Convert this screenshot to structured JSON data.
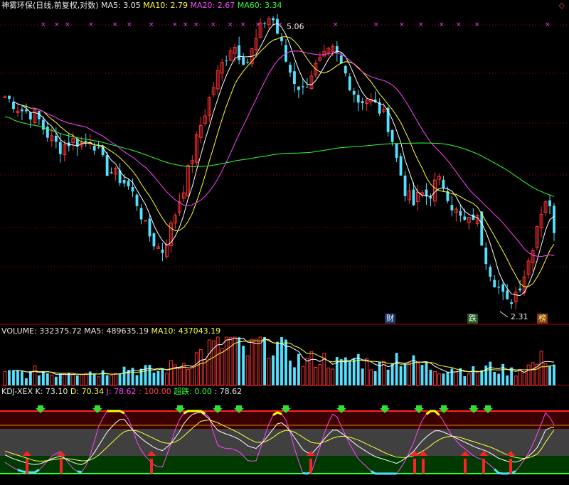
{
  "price_header": {
    "title": "神雾环保(日线,前复权,对数)",
    "ma5": "MA5: 3.05",
    "ma10": "MA10: 2.79",
    "ma20": "MA20: 2.67",
    "ma60": "MA60: 3.34"
  },
  "volume_header": {
    "volume": "VOLUME: 332375.72",
    "ma5": "MA5: 489635.19",
    "ma10": "MA10: 437043.19"
  },
  "kdj_header": {
    "name": "KDJ-XEX",
    "k": "K: 73.10",
    "d": "D: 70.34",
    "j": "J: 78.62",
    "line100": ": 100.00",
    "chaodie": "超跌: 0.00",
    "extra": ": 78.62"
  },
  "annotations": {
    "high_label": "5.06",
    "low_label": "2.31",
    "tag_cai": "财",
    "tag_die": "跌",
    "tag_bang": "榜"
  },
  "colors": {
    "up": "#ff3333",
    "down": "#55e0ff",
    "ma5": "#ffffff",
    "ma10": "#ffff33",
    "ma20": "#ff44ff",
    "ma60": "#33ff33",
    "grid": "#aa0000"
  },
  "chart_data": {
    "type": "candlestick",
    "title": "神雾环保(日线,前复权,对数)",
    "high": 5.06,
    "low": 2.31,
    "last_values": {
      "ma5": 3.05,
      "ma10": 2.79,
      "ma20": 2.67,
      "ma60": 3.34,
      "volume": 332375.72,
      "vol_ma5": 489635.19,
      "vol_ma10": 437043.19,
      "k": 73.1,
      "d": 70.34,
      "j": 78.62
    },
    "close_path": [
      4.06,
      4.0,
      3.92,
      3.9,
      3.86,
      3.72,
      3.62,
      3.55,
      3.6,
      3.62,
      3.58,
      3.66,
      3.48,
      3.35,
      3.31,
      3.26,
      3.18,
      3.05,
      2.86,
      2.77,
      2.7,
      2.85,
      3.05,
      3.25,
      3.5,
      3.78,
      4.02,
      4.28,
      4.48,
      4.68,
      4.52,
      4.46,
      4.7,
      4.95,
      5.02,
      4.72,
      4.4,
      4.22,
      4.12,
      4.32,
      4.42,
      4.52,
      4.58,
      4.38,
      4.2,
      4.02,
      4.05,
      3.98,
      3.9,
      3.75,
      3.42,
      3.18,
      3.05,
      3.15,
      3.12,
      3.25,
      3.22,
      3.05,
      2.95,
      2.9,
      3.0,
      2.72,
      2.55,
      2.45,
      2.35,
      2.42,
      2.52,
      2.68,
      2.95,
      3.12,
      2.88
    ],
    "volume_path": [
      10,
      11,
      12,
      9,
      13,
      12,
      10,
      11,
      14,
      12,
      13,
      12,
      11,
      12,
      14,
      15,
      16,
      13,
      14,
      12,
      13,
      16,
      18,
      20,
      24,
      28,
      32,
      34,
      37,
      40,
      30,
      28,
      34,
      38,
      40,
      32,
      28,
      24,
      20,
      22,
      24,
      22,
      20,
      18,
      22,
      24,
      20,
      18,
      16,
      24,
      26,
      22,
      20,
      18,
      16,
      14,
      15,
      16,
      14,
      13,
      12,
      15,
      16,
      14,
      13,
      12,
      16,
      17,
      20,
      26,
      18
    ],
    "k_path": [
      30,
      24,
      20,
      16,
      14,
      18,
      24,
      28,
      22,
      16,
      14,
      26,
      46,
      66,
      80,
      90,
      74,
      60,
      50,
      42,
      36,
      46,
      62,
      84,
      96,
      98,
      88,
      70,
      64,
      60,
      54,
      44,
      40,
      52,
      68,
      84,
      74,
      56,
      38,
      30,
      44,
      60,
      72,
      64,
      54,
      44,
      36,
      28,
      24,
      20,
      16,
      24,
      34,
      50,
      62,
      70,
      66,
      60,
      54,
      48,
      42,
      38,
      32,
      24,
      20,
      18,
      22,
      30,
      44,
      72,
      74
    ],
    "d_path": [
      36,
      32,
      28,
      24,
      20,
      20,
      22,
      24,
      24,
      22,
      20,
      22,
      30,
      42,
      54,
      66,
      70,
      68,
      62,
      56,
      50,
      48,
      52,
      62,
      74,
      84,
      86,
      82,
      76,
      70,
      64,
      56,
      50,
      50,
      56,
      66,
      70,
      66,
      58,
      50,
      48,
      52,
      58,
      60,
      58,
      54,
      48,
      42,
      36,
      30,
      26,
      26,
      28,
      34,
      42,
      52,
      58,
      60,
      58,
      54,
      50,
      46,
      42,
      36,
      30,
      26,
      24,
      26,
      32,
      52,
      70
    ],
    "j_path": [
      18,
      10,
      4,
      2,
      2,
      14,
      28,
      36,
      18,
      4,
      2,
      34,
      78,
      100,
      100,
      100,
      82,
      44,
      26,
      14,
      8,
      42,
      82,
      100,
      100,
      100,
      92,
      46,
      40,
      40,
      34,
      20,
      20,
      56,
      92,
      100,
      82,
      36,
      0,
      0,
      36,
      76,
      100,
      72,
      46,
      24,
      12,
      0,
      0,
      0,
      0,
      20,
      46,
      82,
      100,
      100,
      82,
      60,
      46,
      36,
      26,
      22,
      12,
      0,
      0,
      2,
      18,
      38,
      68,
      100,
      78
    ]
  }
}
